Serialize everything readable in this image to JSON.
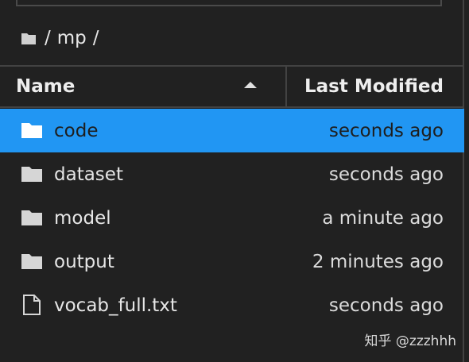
{
  "breadcrumb": {
    "segments": [
      "/",
      "mp",
      "/"
    ]
  },
  "header": {
    "name_label": "Name",
    "modified_label": "Last Modified",
    "sort_direction": "ascending"
  },
  "files": [
    {
      "name": "code",
      "modified": "seconds ago",
      "type": "folder",
      "selected": true
    },
    {
      "name": "dataset",
      "modified": "seconds ago",
      "type": "folder",
      "selected": false
    },
    {
      "name": "model",
      "modified": "a minute ago",
      "type": "folder",
      "selected": false
    },
    {
      "name": "output",
      "modified": "2 minutes ago",
      "type": "folder",
      "selected": false
    },
    {
      "name": "vocab_full.txt",
      "modified": "seconds ago",
      "type": "file",
      "selected": false
    }
  ],
  "watermark": "知乎 @zzzhhh",
  "colors": {
    "background": "#212121",
    "selection": "#2196f3",
    "divider": "#424242"
  }
}
